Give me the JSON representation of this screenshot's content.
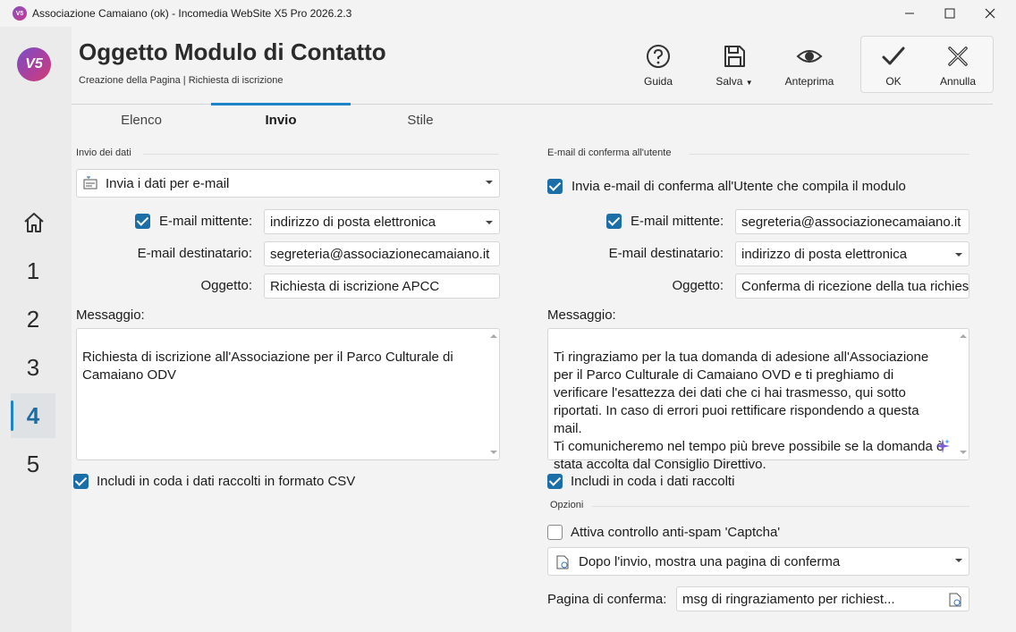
{
  "window": {
    "title": "Associazione Camaiano (ok) - Incomedia WebSite X5 Pro 2026.2.3",
    "app_icon_text": "V5",
    "controls": [
      "minimize-icon",
      "maximize-icon",
      "close-icon"
    ]
  },
  "sidebar": {
    "logo_text": "V5",
    "home_icon": "home-icon",
    "steps": [
      "1",
      "2",
      "3",
      "4",
      "5"
    ],
    "active_step": "4"
  },
  "header": {
    "title": "Oggetto Modulo di Contatto",
    "breadcrumb": "Creazione della Pagina | Richiesta di iscrizione",
    "toolbar": {
      "help_label": "Guida",
      "save_label": "Salva",
      "preview_label": "Anteprima",
      "ok_label": "OK",
      "cancel_label": "Annulla"
    }
  },
  "tabs": [
    {
      "label": "Elenco",
      "active": false
    },
    {
      "label": "Invio",
      "active": true
    },
    {
      "label": "Stile",
      "active": false
    }
  ],
  "left": {
    "section_title": "Invio dei dati",
    "send_mode": "Invia i dati per e-mail",
    "sender_checkbox_label": "E-mail mittente:",
    "sender_checked": true,
    "sender_value": "indirizzo di posta elettronica",
    "recipient_label": "E-mail destinatario:",
    "recipient_value": "segreteria@associazionecamaiano.it",
    "subject_label": "Oggetto:",
    "subject_value": "Richiesta di iscrizione APCC",
    "message_label": "Messaggio:",
    "message_value": "Richiesta di iscrizione all'Associazione per il Parco Culturale di Camaiano ODV",
    "csv_label": "Includi in coda i dati raccolti in formato CSV",
    "csv_checked": true
  },
  "right": {
    "section_title": "E-mail di conferma all'utente",
    "confirm_label": "Invia e-mail di conferma all'Utente che compila il modulo",
    "confirm_checked": true,
    "sender_checkbox_label": "E-mail mittente:",
    "sender_checked": true,
    "sender_value": "segreteria@associazionecamaiano.it",
    "recipient_label": "E-mail destinatario:",
    "recipient_value": "indirizzo di posta elettronica",
    "subject_label": "Oggetto:",
    "subject_value": "Conferma di ricezione della tua richiesta",
    "message_label": "Messaggio:",
    "message_value": "Ti ringraziamo per la tua domanda di adesione all'Associazione per il Parco Culturale di Camaiano OVD e ti preghiamo di verificare l'esattezza dei dati che ci hai trasmesso, qui sotto riportati. In caso di errori puoi rettificare rispondendo a questa mail.\nTi comunicheremo nel tempo più breve possibile se la domanda è stata accolta dal Consiglio Direttivo.",
    "include_label": "Includi in coda i dati raccolti",
    "include_checked": true
  },
  "options": {
    "section_title": "Opzioni",
    "captcha_label": "Attiva controllo anti-spam 'Captcha'",
    "captcha_checked": false,
    "after_send": "Dopo l'invio, mostra una pagina di conferma",
    "confirm_page_label": "Pagina di conferma:",
    "confirm_page_value": "msg di ringraziamento per richiest..."
  },
  "colors": {
    "accent": "#1e84c9",
    "checkbox": "#1c6fa6",
    "background": "#f3f3f3"
  }
}
